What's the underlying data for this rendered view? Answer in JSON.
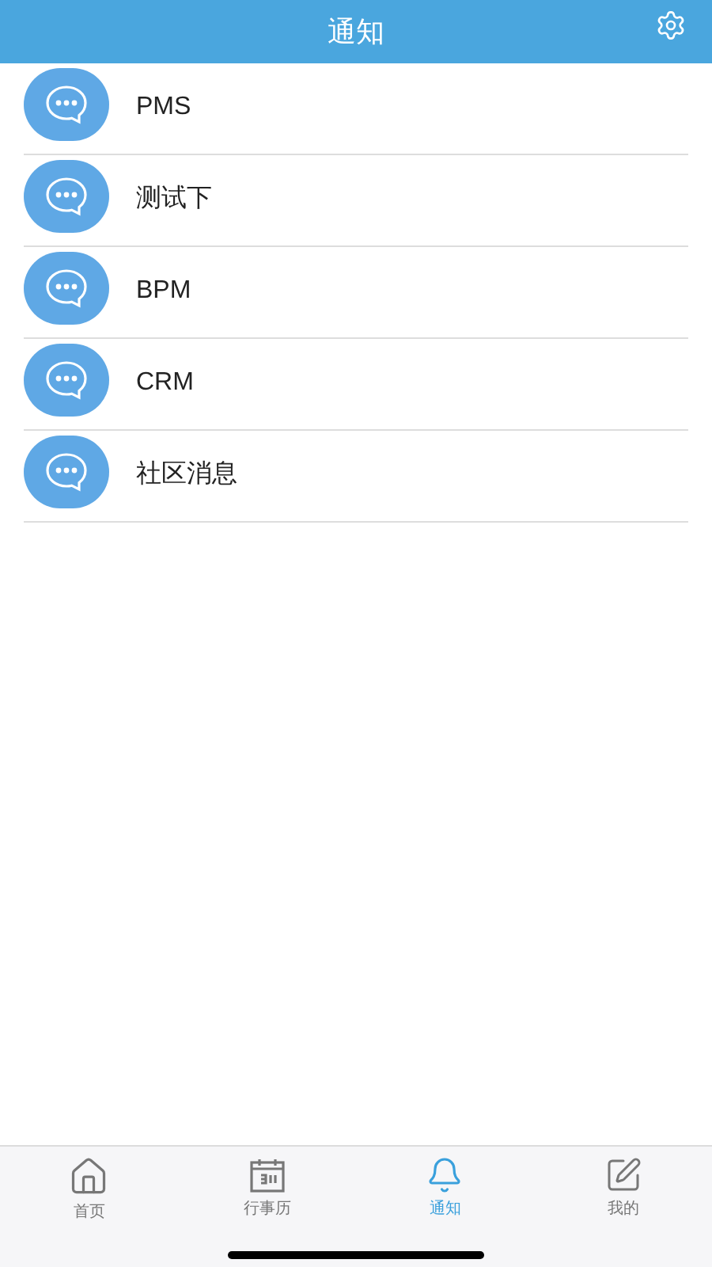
{
  "header": {
    "title": "通知"
  },
  "notifications": [
    {
      "name": "PMS"
    },
    {
      "name": "测试下"
    },
    {
      "name": "BPM"
    },
    {
      "name": "CRM"
    },
    {
      "name": "社区消息"
    }
  ],
  "tab_bar": [
    {
      "kind": "home",
      "label": "首页",
      "selected": false
    },
    {
      "kind": "calendar",
      "label": "行事历",
      "selected": false
    },
    {
      "kind": "bell",
      "label": "通知",
      "selected": true
    },
    {
      "kind": "edit",
      "label": "我的",
      "selected": false
    }
  ]
}
